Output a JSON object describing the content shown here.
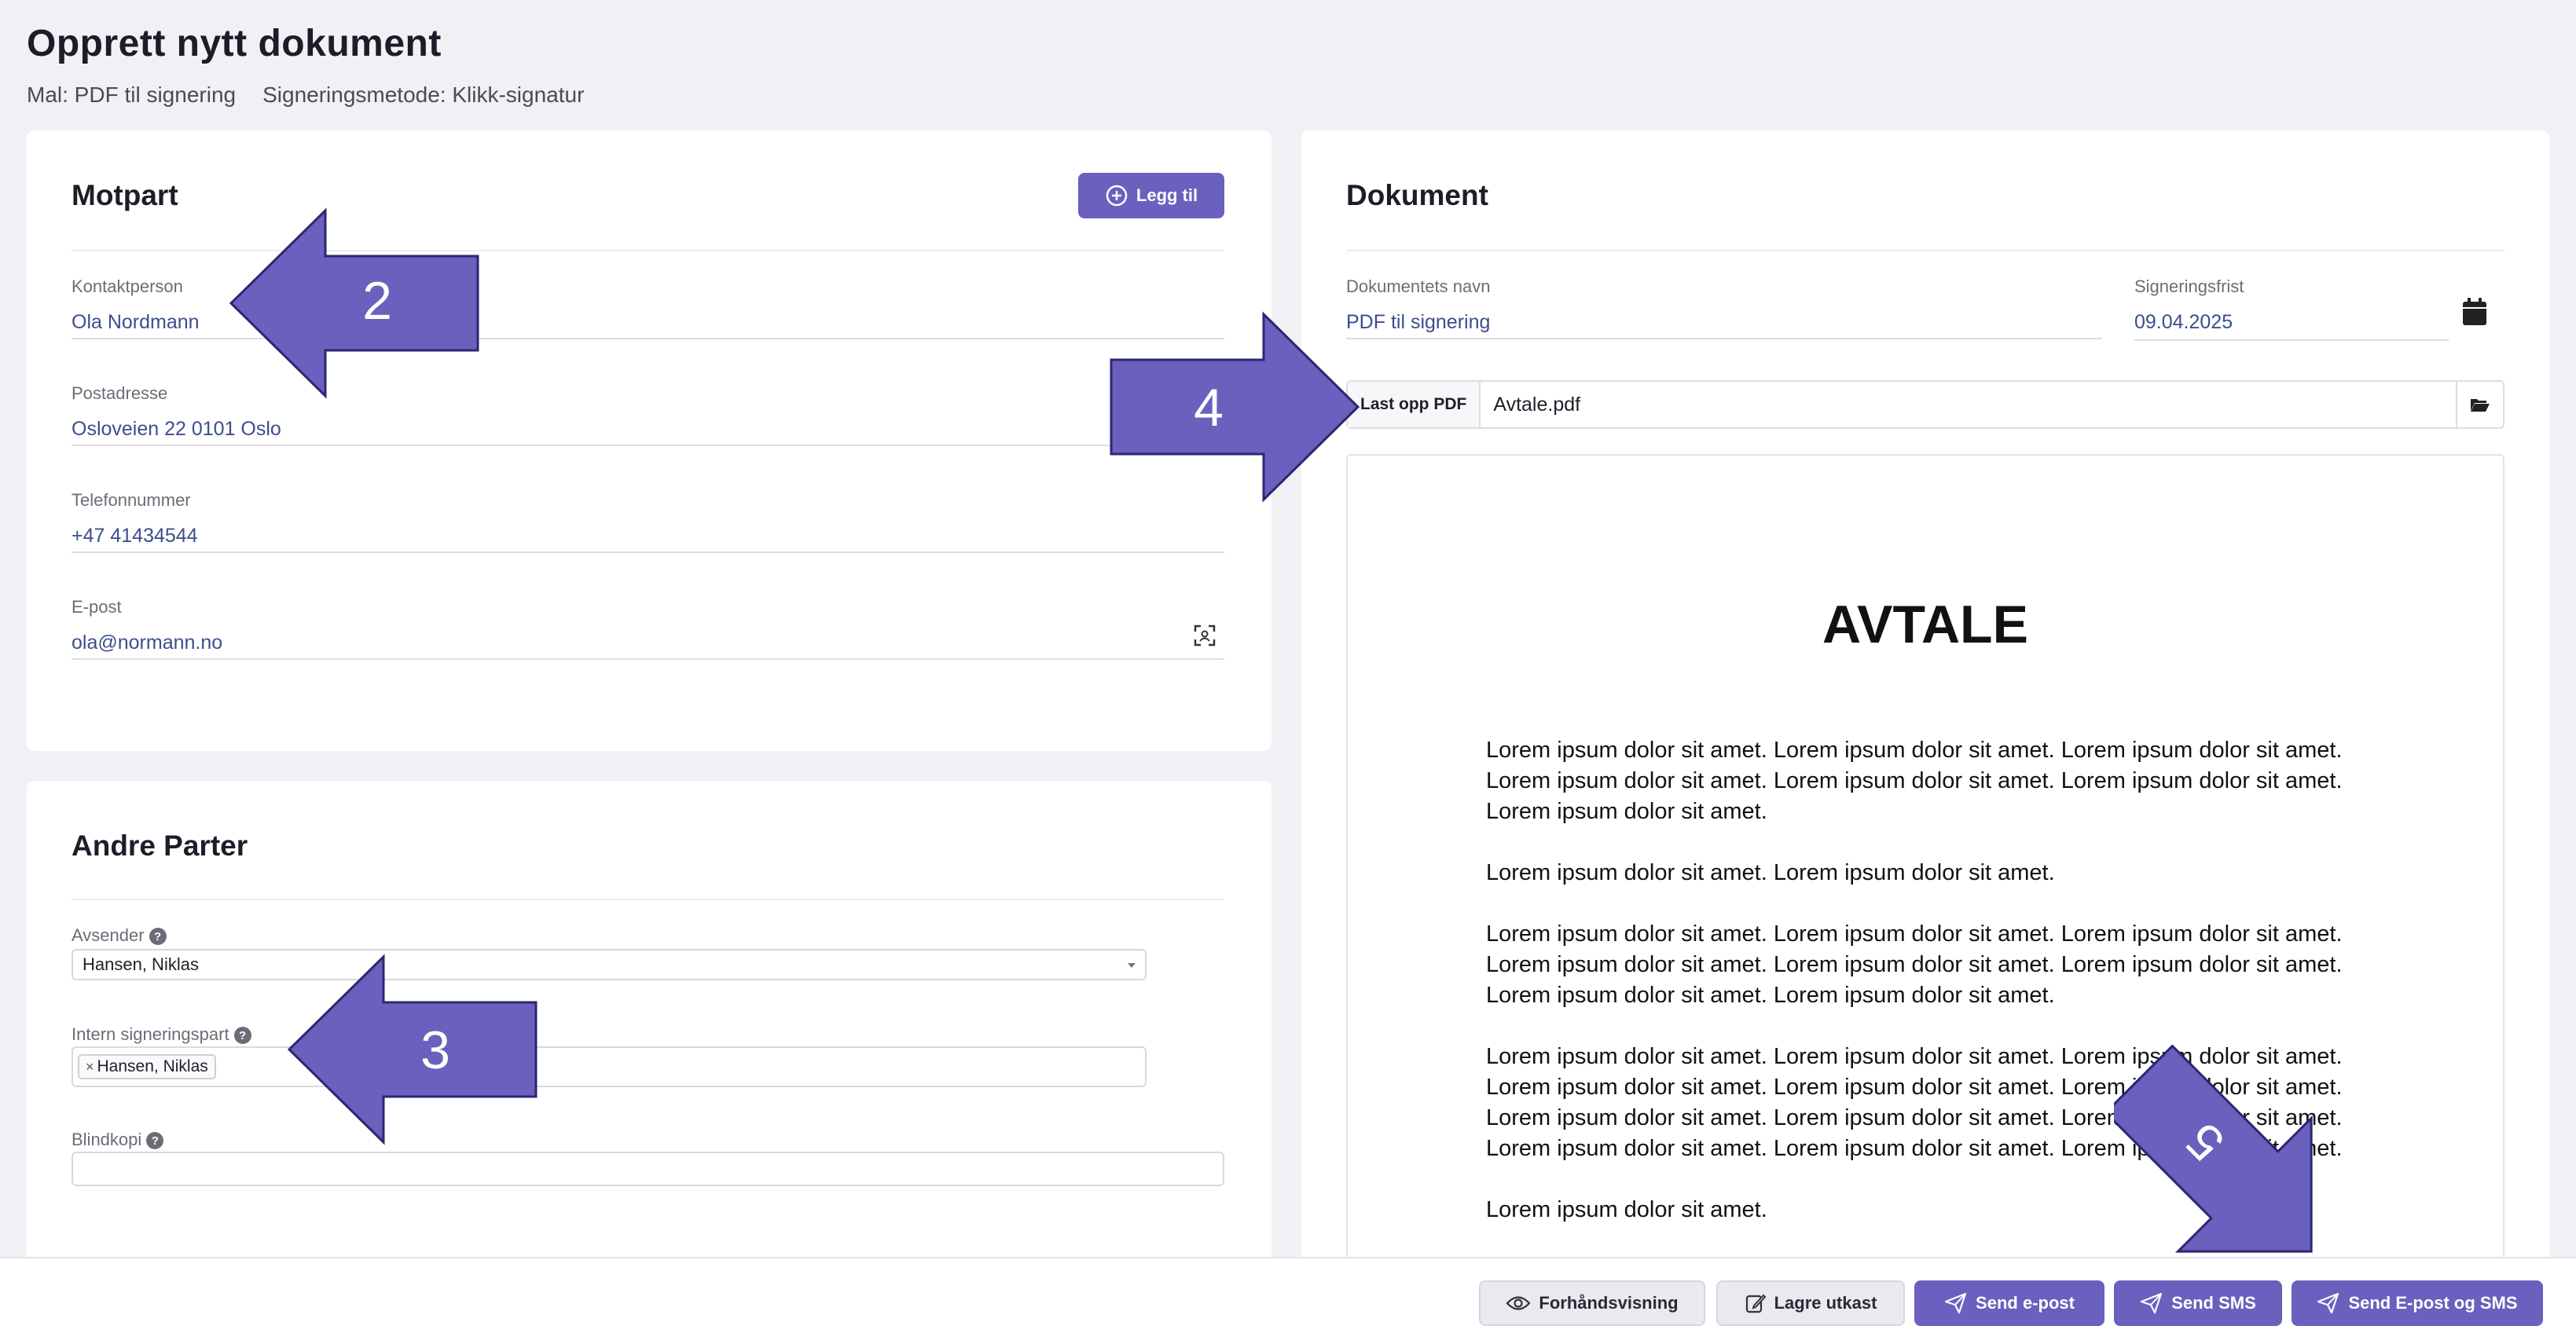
{
  "header": {
    "title": "Opprett nytt dokument",
    "template": "Mal: PDF til signering",
    "method": "Signeringsmetode: Klikk-signatur"
  },
  "motpart": {
    "title": "Motpart",
    "add_label": "Legg til",
    "contact_label": "Kontaktperson",
    "contact_value": "Ola Nordmann",
    "address_label": "Postadresse",
    "address_value": "Osloveien 22 0101 Oslo",
    "phone_label": "Telefonnummer",
    "phone_value": "+47 41434544",
    "email_label": "E-post",
    "email_value": "ola@normann.no"
  },
  "andre": {
    "title": "Andre Parter",
    "sender_label": "Avsender",
    "sender_value": "Hansen, Niklas",
    "internal_label": "Intern signeringspart",
    "internal_tag": "Hansen, Niklas",
    "bcc_label": "Blindkopi"
  },
  "dokument": {
    "title": "Dokument",
    "name_label": "Dokumentets navn",
    "name_value": "PDF til signering",
    "deadline_label": "Signeringsfrist",
    "deadline_value": "09.04.2025",
    "upload_label": "Last opp PDF",
    "file_name": "Avtale.pdf",
    "pdf_title": "AVTALE",
    "pdf_paragraphs": [
      "Lorem ipsum dolor sit amet. Lorem ipsum dolor sit amet. Lorem ipsum dolor sit amet. Lorem ipsum dolor sit amet. Lorem ipsum dolor sit amet. Lorem ipsum dolor sit amet. Lorem ipsum dolor sit amet.",
      "Lorem ipsum dolor sit amet. Lorem ipsum dolor sit amet.",
      "Lorem ipsum dolor sit amet. Lorem ipsum dolor sit amet. Lorem ipsum dolor sit amet. Lorem ipsum dolor sit amet. Lorem ipsum dolor sit amet. Lorem ipsum dolor sit amet. Lorem ipsum dolor sit amet. Lorem ipsum dolor sit amet.",
      "Lorem ipsum dolor sit amet. Lorem ipsum dolor sit amet. Lorem ipsum dolor sit amet. Lorem ipsum dolor sit amet. Lorem ipsum dolor sit amet. Lorem ipsum dolor sit amet. Lorem ipsum dolor sit amet. Lorem ipsum dolor sit amet. Lorem ipsum dolor sit amet. Lorem ipsum dolor sit amet. Lorem ipsum dolor sit amet. Lorem ipsum dolor sit amet.",
      "Lorem ipsum dolor sit amet."
    ]
  },
  "actions": {
    "preview": "Forhåndsvisning",
    "draft": "Lagre utkast",
    "send_email": "Send e-post",
    "send_sms": "Send SMS",
    "send_both": "Send E-post og SMS"
  },
  "annotations": {
    "arrow_2": "2",
    "arrow_3": "3",
    "arrow_4": "4",
    "arrow_5": "5",
    "color": "#6a60be"
  }
}
